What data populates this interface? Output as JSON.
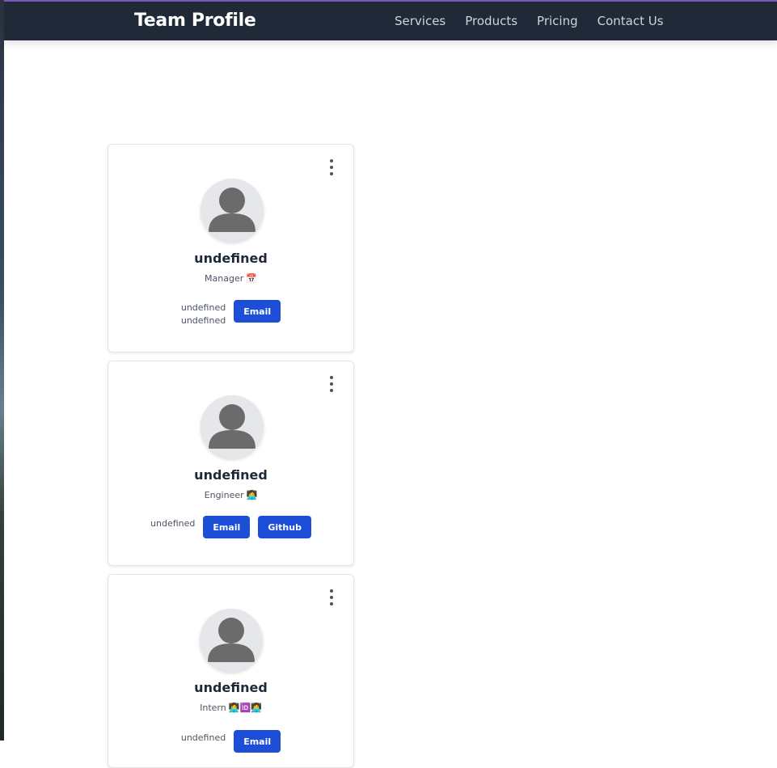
{
  "header": {
    "brand": "Team Profile",
    "nav": [
      "Services",
      "Products",
      "Pricing",
      "Contact Us"
    ]
  },
  "colors": {
    "navbar": "#1f2937",
    "accent": "#1d4ed8"
  },
  "cards": [
    {
      "name": "undefined",
      "role": "Manager",
      "role_icon": "📅",
      "contact_lines": [
        "undefined",
        "undefined"
      ],
      "buttons": [
        "Email"
      ]
    },
    {
      "name": "undefined",
      "role": "Engineer",
      "role_icon": "👩‍💻",
      "contact_lines": [
        "undefined"
      ],
      "buttons": [
        "Email",
        "Github"
      ]
    },
    {
      "name": "undefined",
      "role": "Intern",
      "role_icon": "👩‍💻🆔👩‍💻",
      "contact_lines": [
        "undefined"
      ],
      "buttons": [
        "Email"
      ]
    }
  ]
}
